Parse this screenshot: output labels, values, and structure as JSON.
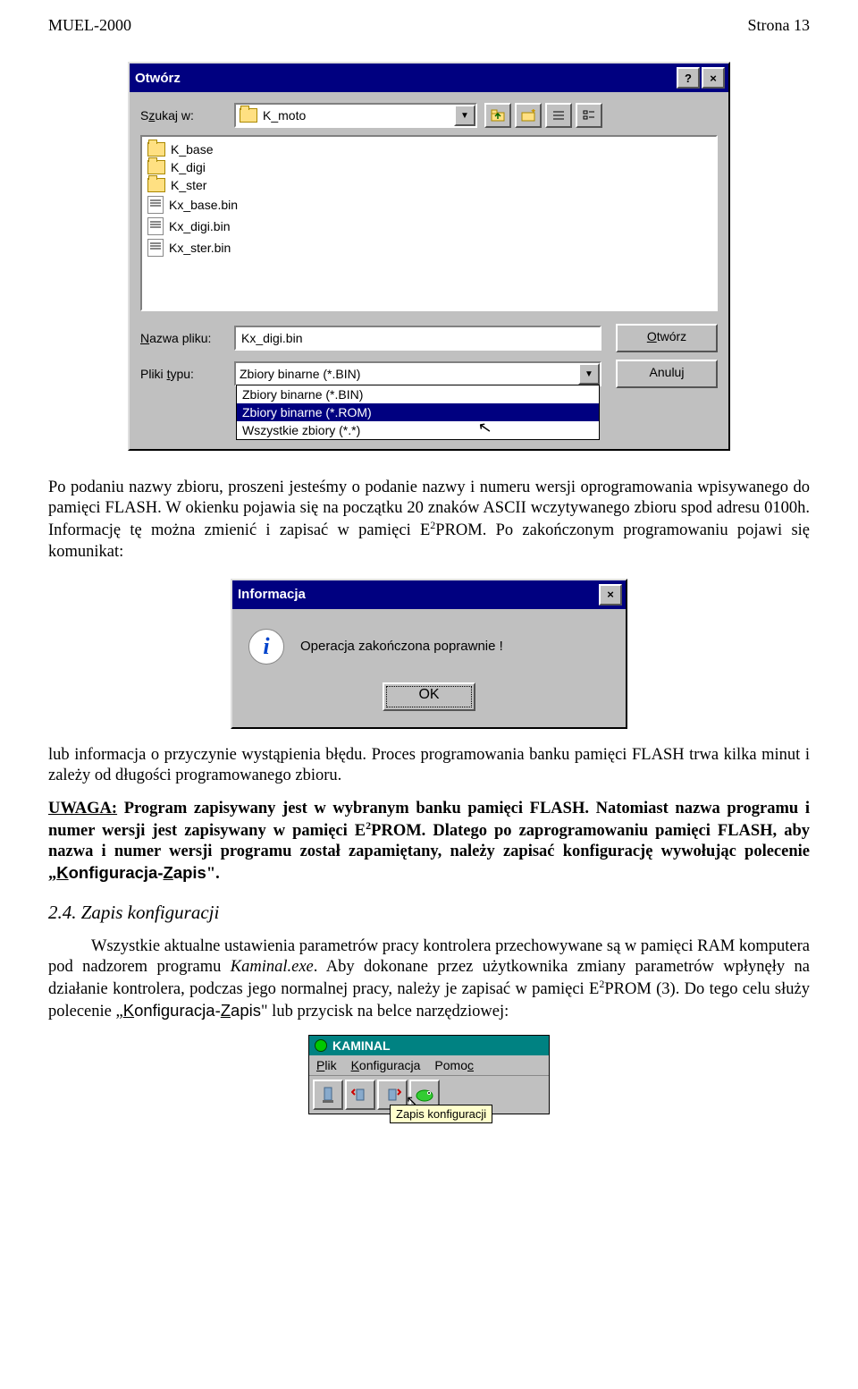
{
  "header": {
    "left": "MUEL-2000",
    "right": "Strona 13"
  },
  "dialog": {
    "title": "Otwórz",
    "lookin_label_pre": "S",
    "lookin_label_und": "z",
    "lookin_label_post": "ukaj w:",
    "lookin_value": "K_moto",
    "items": [
      "K_base",
      "K_digi",
      "K_ster",
      "Kx_base.bin",
      "Kx_digi.bin",
      "Kx_ster.bin"
    ],
    "filename_label_pre": "",
    "filename_label_und": "N",
    "filename_label_post": "azwa pliku:",
    "filename_value": "Kx_digi.bin",
    "filetype_label_pre": "Pliki ",
    "filetype_label_und": "t",
    "filetype_label_post": "ypu:",
    "filetype_value": "Zbiory binarne (*.BIN)",
    "filetype_options": [
      "Zbiory binarne (*.BIN)",
      "Zbiory binarne (*.ROM)",
      "Wszystkie zbiory (*.*)"
    ],
    "filetype_selected_index": 1,
    "open_btn_und": "O",
    "open_btn_rest": "twórz",
    "cancel_btn": "Anuluj"
  },
  "p1": "Po podaniu nazwy zbioru, proszeni jesteśmy o podanie nazwy i numeru wersji oprogramowania wpisywanego do pamięci FLASH. W okienku pojawia się na początku 20 znaków ASCII wczytywanego zbioru spod adresu 0100h. Informację tę można zmienić i zapisać w pamięci E",
  "p1b": "PROM. Po zakończonym programowaniu pojawi się komunikat:",
  "msg": {
    "title": "Informacja",
    "text": "Operacja zakończona poprawnie !",
    "ok": "OK"
  },
  "p2": "lub informacja o przyczynie wystąpienia błędu. Proces programowania banku pamięci FLASH trwa kilka minut i zależy od długości programowanego zbioru.",
  "p3a": "UWAGA:",
  "p3b": " Program zapisywany jest w wybranym banku pamięci FLASH. Natomiast nazwa programu i numer wersji jest zapisywany w pamięci E",
  "p3c": "PROM. Dlatego po zaprogramowaniu pamięci FLASH, aby nazwa i numer wersji programu został zapamiętany, należy zapisać konfigurację wywołując polecenie „",
  "p3d_K": "K",
  "p3d_k": "onfiguracja-",
  "p3d_Z": "Z",
  "p3d_z": "apis",
  "p3e": "\".",
  "h2": "2.4. Zapis konfiguracji",
  "p4a": "Wszystkie aktualne ustawienia parametrów pracy kontrolera przechowywane są w pamięci RAM komputera pod nadzorem programu ",
  "p4i": "Kaminal.exe",
  "p4b": ". Aby dokonane przez użytkownika zmiany parametrów wpłynęły na działanie kontrolera, podczas jego normalnej pracy, należy je zapisać w pamięci E",
  "p4c": "PROM (3). Do tego celu służy polecenie „",
  "p4d_K": "K",
  "p4d_k": "onfiguracja-",
  "p4d_Z": "Z",
  "p4d_z": "apis",
  "p4e": "\" lub przycisk na belce narzędziowej:",
  "toolbar": {
    "title": "KAMINAL",
    "menu_P": "P",
    "menu_p": "lik",
    "menu_K": "K",
    "menu_k": "onfiguracja",
    "menu_Pm": "P",
    "menu_pm": "omo",
    "menu_c": "c",
    "tooltip": "Zapis konfiguracji"
  }
}
